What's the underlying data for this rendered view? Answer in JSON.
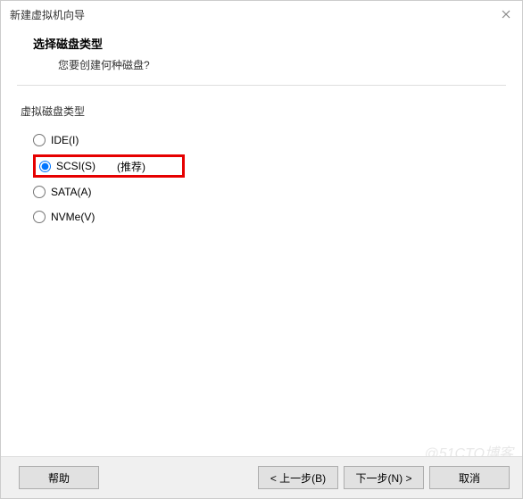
{
  "window": {
    "title": "新建虚拟机向导"
  },
  "header": {
    "heading": "选择磁盘类型",
    "subtext": "您要创建何种磁盘?"
  },
  "group": {
    "label": "虚拟磁盘类型",
    "options": {
      "ide": "IDE(I)",
      "scsi": "SCSI(S)",
      "scsi_recommend": "(推荐)",
      "sata": "SATA(A)",
      "nvme": "NVMe(V)"
    },
    "selected": "scsi"
  },
  "buttons": {
    "help": "帮助",
    "back": "< 上一步(B)",
    "next": "下一步(N) >",
    "cancel": "取消"
  },
  "watermark": "@51CTO博客"
}
